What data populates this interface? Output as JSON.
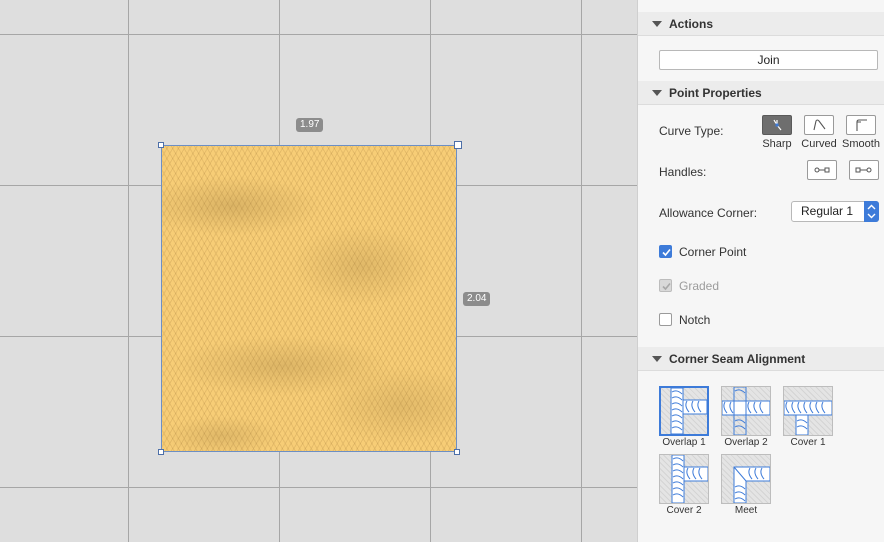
{
  "canvas": {
    "width_label": "1.97",
    "height_label": "2.04",
    "fabric_color": "#f7cd76"
  },
  "panel": {
    "actions": {
      "title": "Actions",
      "join_label": "Join"
    },
    "point_properties": {
      "title": "Point Properties",
      "curve_type_label": "Curve Type:",
      "curve_types": [
        "Sharp",
        "Curved",
        "Smooth"
      ],
      "selected_curve_type": "Sharp",
      "handles_label": "Handles:",
      "allowance_corner_label": "Allowance Corner:",
      "allowance_corner_value": "Regular 1",
      "corner_point_label": "Corner Point",
      "corner_point_checked": true,
      "graded_label": "Graded",
      "graded_checked": true,
      "graded_disabled": true,
      "notch_label": "Notch",
      "notch_checked": false
    },
    "corner_seam_alignment": {
      "title": "Corner Seam Alignment",
      "options": [
        "Overlap 1",
        "Overlap 2",
        "Cover 1",
        "Cover 2",
        "Meet"
      ],
      "selected": "Overlap 1"
    }
  },
  "colors": {
    "accent": "#3d7bd9",
    "canvas_bg": "#dedede",
    "grid_line": "#a6a6a6",
    "panel_bg": "#f6f6f6"
  }
}
